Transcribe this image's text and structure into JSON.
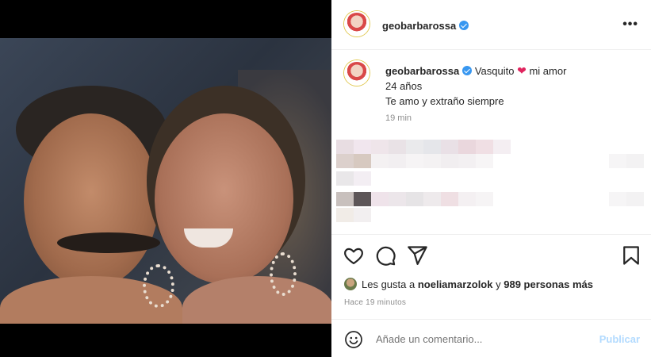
{
  "header": {
    "username": "geobarbarossa",
    "more_icon": "more-horizontal-icon"
  },
  "caption": {
    "username": "geobarbarossa",
    "line1_text": "Vasquito",
    "line1_after": "mi amor",
    "line2": "24 años",
    "line3": "Te amo y extraño siempre",
    "time": "19 min"
  },
  "likes": {
    "prefix": "Les gusta a",
    "user": "noeliamarzolok",
    "middle": "y",
    "count": "989 personas más"
  },
  "posted_ago": "Hace 19 minutos",
  "comment": {
    "placeholder": "Añade un comentario...",
    "publish_label": "Publicar"
  },
  "colors": {
    "accent": "#3897f0",
    "heart": "#e0245e",
    "publish_disabled": "#b3dbff"
  }
}
